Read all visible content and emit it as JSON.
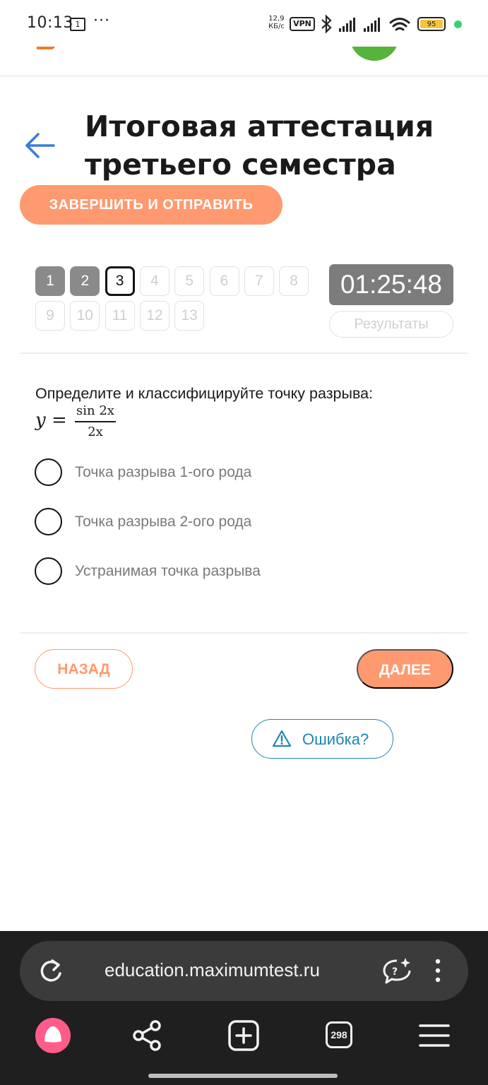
{
  "status_bar": {
    "time": "10:13",
    "calendar_day": "1",
    "more": "···",
    "net_speed_value": "12,9",
    "net_speed_unit": "КБ/с",
    "vpn": "VPN",
    "battery": "95"
  },
  "page": {
    "title": "Итоговая аттестация третьего семестра",
    "finish_label": "ЗАВЕРШИТЬ И ОТПРАВИТЬ"
  },
  "question_nav": {
    "items": [
      "1",
      "2",
      "3",
      "4",
      "5",
      "6",
      "7",
      "8",
      "9",
      "10",
      "11",
      "12",
      "13"
    ],
    "answered": [
      "1",
      "2"
    ],
    "current": "3"
  },
  "timer": "01:25:48",
  "results_label": "Результаты",
  "question": {
    "text": "Определите и классифицируйте точку разрыва:",
    "formula_lhs": "y =",
    "formula_num": "sin 2x",
    "formula_den": "2x",
    "options": [
      "Точка разрыва 1-ого рода",
      "Точка разрыва 2-ого рода",
      "Устранимая точка разрыва"
    ]
  },
  "actions": {
    "back_label": "НАЗАД",
    "next_label": "ДАЛЕЕ",
    "error_label": "Ошибка?"
  },
  "browser": {
    "url": "education.maximumtest.ru",
    "tab_count": "298"
  },
  "colors": {
    "accent": "#ff9a70",
    "link": "#1d86b0",
    "timer_bg": "#7c7c7c",
    "answered_bg": "#8a8a8a",
    "back_arrow": "#3a7bd5"
  }
}
